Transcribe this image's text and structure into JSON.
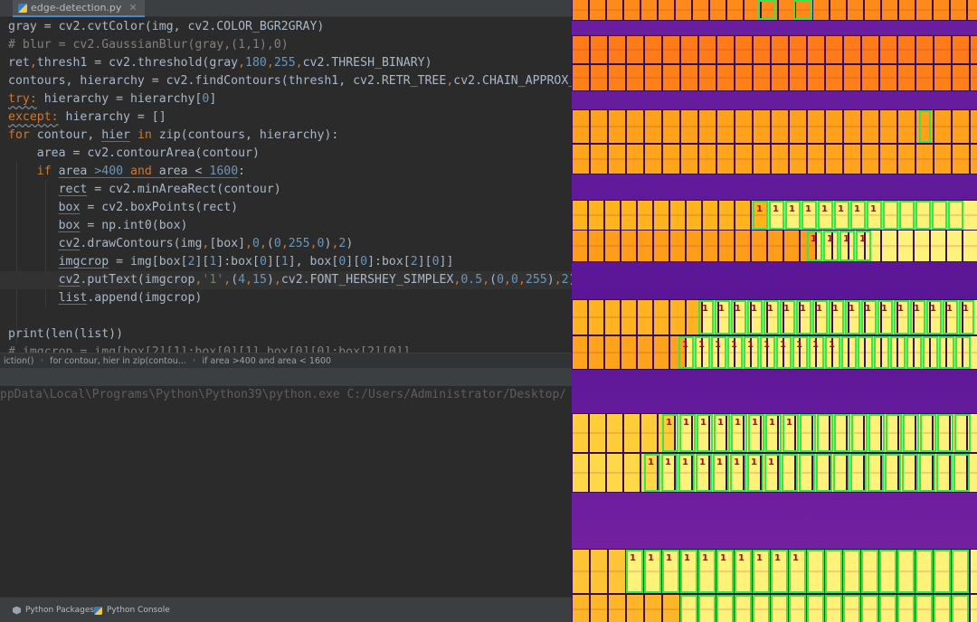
{
  "editor_tab": {
    "filename": "edge-detection.py",
    "icon": "python-file-icon"
  },
  "breadcrumbs": [
    "iction()",
    "for contour, hier in zip(contou...",
    "if area >400 and area < 1600"
  ],
  "console": {
    "command_line": "ppData\\Local\\Programs\\Python\\Python39\\python.exe C:/Users/Administrator/Desktop/"
  },
  "bottom_tabs": [
    {
      "label": "Python Packages",
      "icon": "package-icon"
    },
    {
      "label": "Python Console",
      "icon": "python-console-icon"
    }
  ],
  "thermal_image": {
    "label_text": "1",
    "box_color": "#39e64a",
    "label_color": "#b0002a"
  },
  "colors": {
    "keyword": "#cc7832",
    "number": "#6897bb",
    "comment": "#808080",
    "text": "#a9b7c6",
    "background": "#2b2b2b"
  }
}
